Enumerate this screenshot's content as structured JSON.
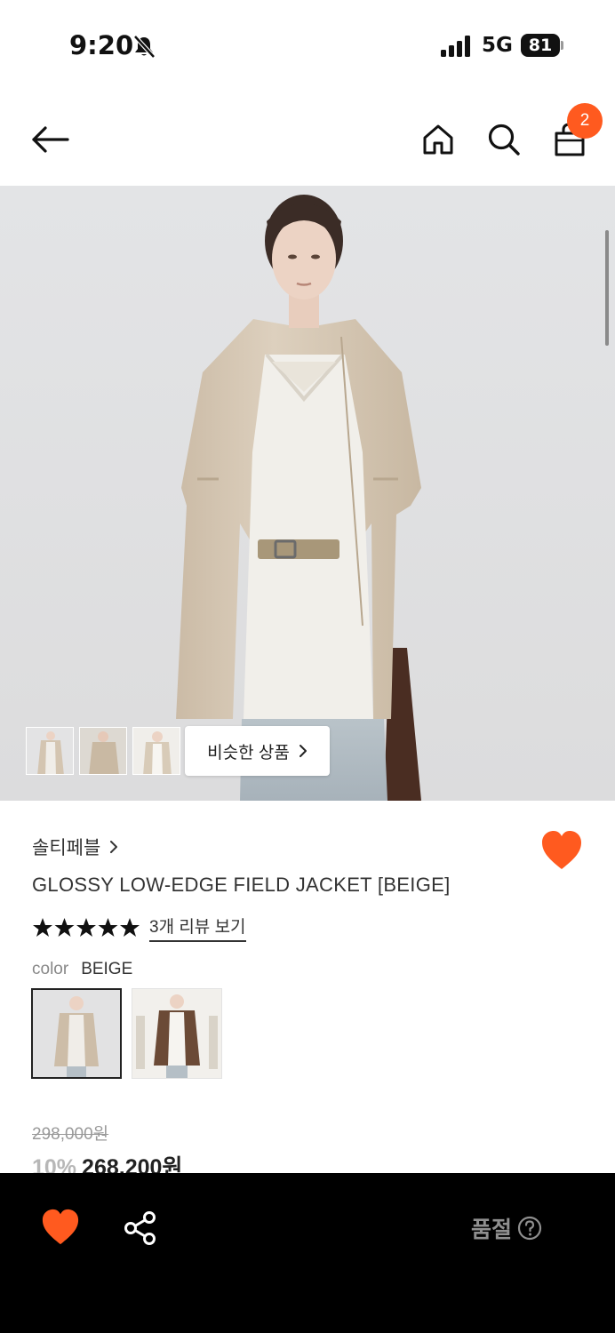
{
  "status_bar": {
    "time": "9:20",
    "network": "5G",
    "battery": "81"
  },
  "header": {
    "cart_count": "2"
  },
  "hero": {
    "similar_label": "비슷한 상품"
  },
  "product": {
    "brand": "솔티페블",
    "title": "GLOSSY LOW-EDGE FIELD JACKET [BEIGE]",
    "rating_stars": 5,
    "review_link": "3개 리뷰 보기",
    "color_label": "color",
    "color_value": "BEIGE",
    "original_price": "298,000원",
    "discount": "10%",
    "price": "268,200원"
  },
  "bottom_bar": {
    "soldout_label": "품절"
  },
  "colors": {
    "accent": "#ff5a1f",
    "bottom_bar_bg": "#000000"
  }
}
